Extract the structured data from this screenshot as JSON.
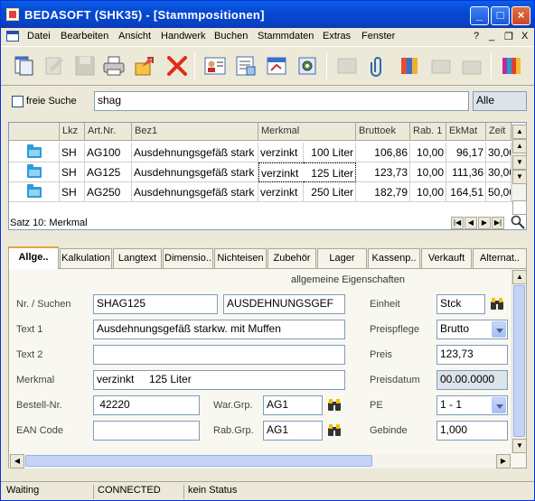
{
  "window": {
    "title": "BEDASOFT (SHK35) - [Stammpositionen]"
  },
  "menu": [
    "Datei",
    "Bearbeiten",
    "Ansicht",
    "Handwerk",
    "Buchen",
    "Stammdaten",
    "Extras",
    "Fenster"
  ],
  "menu_right": [
    "?",
    "_",
    "❐",
    "X"
  ],
  "search": {
    "checkbox_label": "freie Suche",
    "value": "shag",
    "filter": "Alle"
  },
  "grid": {
    "headers": [
      "Lkz",
      "Art.Nr.",
      "Bez1",
      "Merkmal",
      "Bruttoek",
      "Rab. 1",
      "EkMat",
      "Zeit"
    ],
    "rows": [
      [
        "SH",
        "AG100",
        "Ausdehnungsgefäß stark",
        "verzinkt",
        "100 Liter",
        "106,86",
        "10,00",
        "96,17",
        "30,00"
      ],
      [
        "SH",
        "AG125",
        "Ausdehnungsgefäß stark",
        "verzinkt",
        "125 Liter",
        "123,73",
        "10,00",
        "111,36",
        "30,00"
      ],
      [
        "SH",
        "AG250",
        "Ausdehnungsgefäß stark",
        "verzinkt",
        "250 Liter",
        "182,79",
        "10,00",
        "164,51",
        "50,00"
      ]
    ],
    "status": "Satz 10: Merkmal"
  },
  "tabs": [
    "Allge..",
    "Kalkulation",
    "Langtext",
    "Dimensio..",
    "Nichteisen",
    "Zubehör",
    "Lager",
    "Kassenp..",
    "Verkauft",
    "Alternat.."
  ],
  "panel": {
    "section_title": "allgemeine Eigenschaften",
    "nr_label": "Nr. / Suchen",
    "nr": "SHAG125",
    "suchen": "AUSDEHNUNGSGEF",
    "text1_label": "Text 1",
    "text1": "Ausdehnungsgefäß starkw. mit Muffen",
    "text2_label": "Text 2",
    "text2": "",
    "merkmal_label": "Merkmal",
    "merkmal": "verzinkt     125 Liter",
    "bestell_label": "Bestell-Nr.",
    "bestell": " 42220",
    "ean_label": "EAN Code",
    "ean": "",
    "wargrp_label": "War.Grp.",
    "wargrp": "AG1",
    "rabgrp_label": "Rab.Grp.",
    "rabgrp": "AG1",
    "einheit_label": "Einheit",
    "einheit": "Stck",
    "preispflege_label": "Preispflege",
    "preispflege": "Brutto",
    "preis_label": "Preis",
    "preis": "123,73",
    "preisdatum_label": "Preisdatum",
    "preisdatum": "00.00.0000",
    "pe_label": "PE",
    "pe": "1 - 1",
    "gebinde_label": "Gebinde",
    "gebinde": "1,000"
  },
  "status": {
    "state": "Waiting",
    "connection": "CONNECTED",
    "message": "kein Status"
  }
}
